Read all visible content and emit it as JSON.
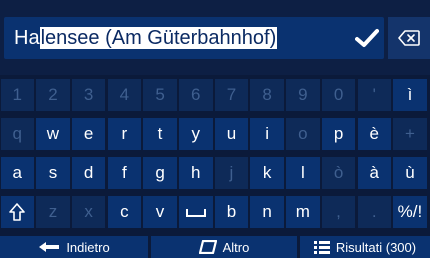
{
  "input": {
    "typed": "Ha",
    "suggestion": "lensee (Am Güterbahnhof)"
  },
  "icons": {
    "confirm": "checkmark-icon",
    "backspace": "backspace-icon",
    "shift": "shift-arrow-icon",
    "space": "space-bar-icon",
    "back": "arrow-left-icon",
    "other": "keyboard-layout-icon",
    "results": "list-icon"
  },
  "keyboard": {
    "rows": [
      [
        {
          "label": "1",
          "enabled": false
        },
        {
          "label": "2",
          "enabled": false
        },
        {
          "label": "3",
          "enabled": false
        },
        {
          "label": "4",
          "enabled": false
        },
        {
          "label": "5",
          "enabled": false
        },
        {
          "label": "6",
          "enabled": false
        },
        {
          "label": "7",
          "enabled": false
        },
        {
          "label": "8",
          "enabled": false
        },
        {
          "label": "9",
          "enabled": false
        },
        {
          "label": "0",
          "enabled": false
        },
        {
          "label": "'",
          "enabled": false
        },
        {
          "label": "ì",
          "enabled": true
        }
      ],
      [
        {
          "label": "q",
          "enabled": false
        },
        {
          "label": "w",
          "enabled": true
        },
        {
          "label": "e",
          "enabled": true
        },
        {
          "label": "r",
          "enabled": true
        },
        {
          "label": "t",
          "enabled": true
        },
        {
          "label": "y",
          "enabled": true
        },
        {
          "label": "u",
          "enabled": true
        },
        {
          "label": "i",
          "enabled": true
        },
        {
          "label": "o",
          "enabled": false
        },
        {
          "label": "p",
          "enabled": true
        },
        {
          "label": "è",
          "enabled": true
        },
        {
          "label": "+",
          "enabled": false
        }
      ],
      [
        {
          "label": "a",
          "enabled": true
        },
        {
          "label": "s",
          "enabled": true
        },
        {
          "label": "d",
          "enabled": true
        },
        {
          "label": "f",
          "enabled": true
        },
        {
          "label": "g",
          "enabled": true
        },
        {
          "label": "h",
          "enabled": true
        },
        {
          "label": "j",
          "enabled": false
        },
        {
          "label": "k",
          "enabled": true
        },
        {
          "label": "l",
          "enabled": true
        },
        {
          "label": "ò",
          "enabled": false
        },
        {
          "label": "à",
          "enabled": true
        },
        {
          "label": "ù",
          "enabled": true
        }
      ],
      [
        {
          "label": "",
          "icon": "shift",
          "enabled": true
        },
        {
          "label": "z",
          "enabled": false
        },
        {
          "label": "x",
          "enabled": false
        },
        {
          "label": "c",
          "enabled": true
        },
        {
          "label": "v",
          "enabled": true
        },
        {
          "label": "",
          "icon": "space",
          "enabled": true
        },
        {
          "label": "b",
          "enabled": true
        },
        {
          "label": "n",
          "enabled": true
        },
        {
          "label": "m",
          "enabled": true
        },
        {
          "label": ",",
          "enabled": false
        },
        {
          "label": ".",
          "enabled": false
        },
        {
          "label": "%/!",
          "enabled": true
        }
      ]
    ]
  },
  "bottom": {
    "back_label": "Indietro",
    "other_label": "Altro",
    "results_label": "Risultati (300)"
  }
}
